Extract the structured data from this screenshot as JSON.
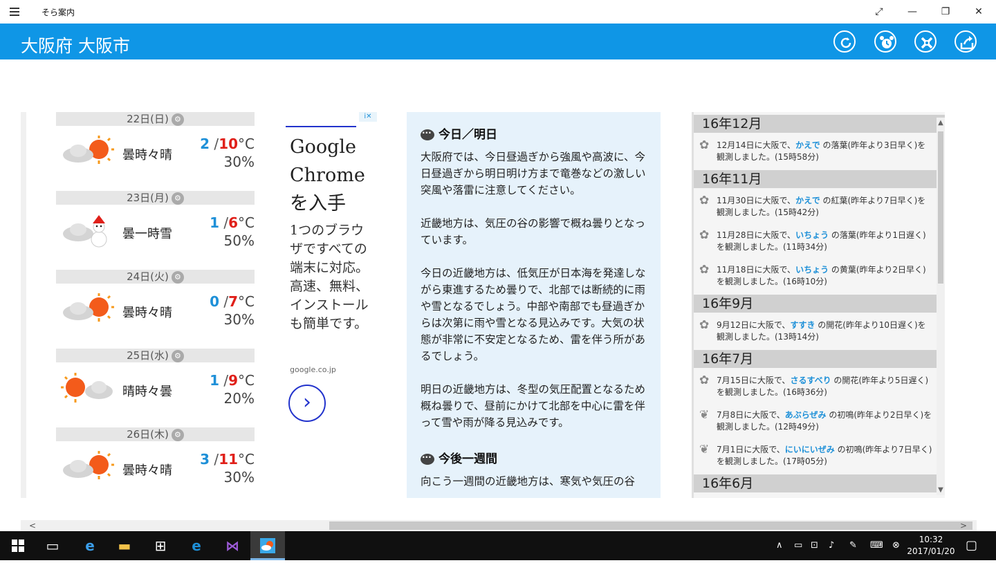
{
  "window": {
    "app_title": "そら案内",
    "controls": [
      "⤢",
      "—",
      "❐",
      "✕"
    ]
  },
  "header": {
    "city": "大阪府 大阪市",
    "buttons": [
      "refresh-icon",
      "alarm-clock-icon",
      "settings-icon",
      "share-icon"
    ]
  },
  "forecast": [
    {
      "date": "22日(日)",
      "icon": "cloud-sun",
      "weather": "曇時々晴",
      "min": "2",
      "max": "10",
      "unit": "°C",
      "prob": "30%"
    },
    {
      "date": "23日(月)",
      "icon": "cloud-snowman",
      "weather": "曇一時雪",
      "min": "1",
      "max": "6",
      "unit": "°C",
      "prob": "50%"
    },
    {
      "date": "24日(火)",
      "icon": "cloud-sun",
      "weather": "曇時々晴",
      "min": "0",
      "max": "7",
      "unit": "°C",
      "prob": "30%"
    },
    {
      "date": "25日(水)",
      "icon": "sun-cloud",
      "weather": "晴時々曇",
      "min": "1",
      "max": "9",
      "unit": "°C",
      "prob": "20%"
    },
    {
      "date": "26日(木)",
      "icon": "cloud-sun",
      "weather": "曇時々晴",
      "min": "3",
      "max": "11",
      "unit": "°C",
      "prob": "30%"
    }
  ],
  "ad": {
    "headline": "Google Chrome を入手",
    "body": "1つのブラウザですべての端末に対応。 高速、無料、インストールも簡単です。",
    "domain": "google.co.jp",
    "badge": "i✕"
  },
  "commentary": {
    "today_heading": "今日／明日",
    "paragraphs": [
      "大阪府では、今日昼過ぎから強風や高波に、今日昼過ぎから明日明け方まで竜巻などの激しい突風や落雷に注意してください。",
      "近畿地方は、気圧の谷の影響で概ね曇りとなっています。",
      "今日の近畿地方は、低気圧が日本海を発達しながら東進するため曇りで、北部では断続的に雨や雪となるでしょう。中部や南部でも昼過ぎからは次第に雨や雪となる見込みです。大気の状態が非常に不安定となるため、雷を伴う所があるでしょう。",
      "明日の近畿地方は、冬型の気圧配置となるため概ね曇りで、昼前にかけて北部を中心に雷を伴って雪や雨が降る見込みです。"
    ],
    "week_heading": "今後一週間",
    "week_text": "向こう一週間の近畿地方は、寒気や気圧の谷"
  },
  "season": [
    {
      "month": "16年12月",
      "items": [
        {
          "icon": "flower",
          "pre": "12月14日に大阪で、",
          "hl": "かえで",
          "post": " の落葉(昨年より3日早く)を観測しました。(15時58分)"
        }
      ]
    },
    {
      "month": "16年11月",
      "items": [
        {
          "icon": "flower",
          "pre": "11月30日に大阪で、",
          "hl": "かえで",
          "post": " の紅葉(昨年より7日早く)を観測しました。(15時42分)"
        },
        {
          "icon": "flower",
          "pre": "11月28日に大阪で、",
          "hl": "いちょう",
          "post": " の落葉(昨年より1日遅く)を観測しました。(11時34分)"
        },
        {
          "icon": "flower",
          "pre": "11月18日に大阪で、",
          "hl": "いちょう",
          "post": " の黄葉(昨年より2日早く)を観測しました。(16時10分)"
        }
      ]
    },
    {
      "month": "16年9月",
      "items": [
        {
          "icon": "flower",
          "pre": "9月12日に大阪で、",
          "hl": "すすき",
          "post": " の開花(昨年より10日遅く)を観測しました。(13時14分)"
        }
      ]
    },
    {
      "month": "16年7月",
      "items": [
        {
          "icon": "flower",
          "pre": "7月15日に大阪で、",
          "hl": "さるすべり",
          "post": " の開花(昨年より5日遅く)を観測しました。(16時36分)"
        },
        {
          "icon": "butterfly",
          "pre": "7月8日に大阪で、",
          "hl": "あぶらぜみ",
          "post": " の初鳴(昨年より2日早く)を観測しました。(12時49分)"
        },
        {
          "icon": "butterfly",
          "pre": "7月1日に大阪で、",
          "hl": "にいにいぜみ",
          "post": " の初鳴(昨年より7日早く)を観測しました。(17時05分)"
        }
      ]
    },
    {
      "month": "16年6月",
      "items": []
    }
  ],
  "taskbar": {
    "time": "10:32",
    "date": "2017/01/20"
  }
}
